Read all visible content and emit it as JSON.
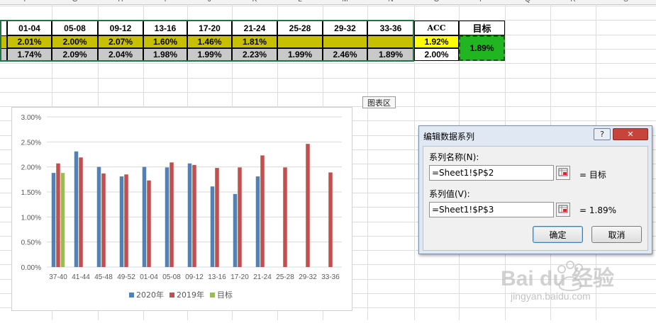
{
  "sheet": {
    "columns": [
      "F",
      "G",
      "H",
      "I",
      "J",
      "K",
      "L",
      "M",
      "N",
      "O",
      "P",
      "Q",
      "R",
      "S"
    ],
    "header_row": [
      "01-04",
      "05-08",
      "09-12",
      "13-16",
      "17-20",
      "21-24",
      "25-28",
      "29-32",
      "33-36"
    ],
    "row_2020": [
      "2.01%",
      "2.00%",
      "2.07%",
      "1.60%",
      "1.46%",
      "1.81%",
      "",
      "",
      ""
    ],
    "row_2019": [
      "1.74%",
      "2.09%",
      "2.04%",
      "1.98%",
      "1.99%",
      "2.23%",
      "1.99%",
      "2.46%",
      "1.89%"
    ],
    "acc_header": "ACC",
    "acc_2020": "1.92%",
    "acc_2019": "2.00%",
    "target_header": "目标",
    "target_value": "1.89%"
  },
  "chart_tag": "图表区",
  "chart_data": {
    "type": "bar",
    "categories": [
      "37-40",
      "41-44",
      "45-48",
      "49-52",
      "01-04",
      "05-08",
      "09-12",
      "13-16",
      "17-20",
      "21-24",
      "25-28",
      "29-32",
      "33-36"
    ],
    "series": [
      {
        "name": "2020年",
        "color": "#4f81bd",
        "values": [
          1.88,
          2.31,
          2.0,
          1.81,
          2.0,
          1.99,
          2.07,
          1.61,
          1.46,
          1.81,
          null,
          null,
          null
        ]
      },
      {
        "name": "2019年",
        "color": "#c0504d",
        "values": [
          2.07,
          2.19,
          1.87,
          1.85,
          1.73,
          2.09,
          2.04,
          1.98,
          1.99,
          2.23,
          1.99,
          2.46,
          1.89
        ]
      },
      {
        "name": "目标",
        "color": "#9bbb59",
        "values": [
          1.88,
          null,
          null,
          null,
          null,
          null,
          null,
          null,
          null,
          null,
          null,
          null,
          null
        ]
      }
    ],
    "ylim": [
      0,
      3
    ],
    "yticks": [
      "0.00%",
      "0.50%",
      "1.00%",
      "1.50%",
      "2.00%",
      "2.50%",
      "3.00%"
    ],
    "grid": true,
    "legend": "bottom"
  },
  "dialog": {
    "title": "编辑数据系列",
    "help": "?",
    "close": "✕",
    "name_label": "系列名称(N):",
    "name_value": "=Sheet1!$P$2",
    "name_result": "= 目标",
    "values_label": "系列值(V):",
    "values_value": "=Sheet1!$P$3",
    "values_result": "= 1.89%",
    "ok": "确定",
    "cancel": "取消"
  },
  "watermark": {
    "brand": "Bai du 经验",
    "url": "jingyan.baidu.com"
  }
}
